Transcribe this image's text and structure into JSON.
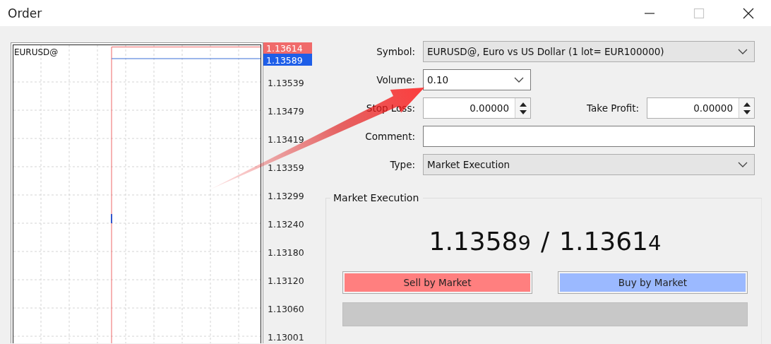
{
  "window": {
    "title": "Order",
    "controls": [
      {
        "kind": "minimize",
        "disabled": false
      },
      {
        "kind": "maximize",
        "disabled": true
      },
      {
        "kind": "close",
        "disabled": false
      }
    ]
  },
  "chart": {
    "symbol": "EURUSD@",
    "ask_label": "1.13614",
    "bid_label": "1.13589",
    "scale": [
      "1.13539",
      "1.13479",
      "1.13419",
      "1.13359",
      "1.13299",
      "1.13240",
      "1.13180",
      "1.13120",
      "1.13060",
      "1.13001"
    ]
  },
  "form": {
    "symbol": {
      "label": "Symbol:",
      "value": "EURUSD@, Euro vs US Dollar (1 lot= EUR100000)"
    },
    "volume": {
      "label": "Volume:",
      "value": "0.10"
    },
    "stop_loss": {
      "label": "Stop Loss:",
      "value": "0.00000"
    },
    "take_profit": {
      "label": "Take Profit:",
      "value": "0.00000"
    },
    "comment": {
      "label": "Comment:"
    },
    "type": {
      "label": "Type:",
      "value": "Market Execution"
    }
  },
  "execution": {
    "title": "Market Execution",
    "bid": {
      "main": "1.1358",
      "small": "9"
    },
    "separator": "/",
    "ask": {
      "main": "1.1361",
      "small": "4"
    },
    "buttons": [
      {
        "kind": "sell",
        "label": "Sell by Market"
      },
      {
        "kind": "buy",
        "label": "Buy by Market"
      }
    ]
  },
  "annotation": {
    "kind": "arrow"
  }
}
